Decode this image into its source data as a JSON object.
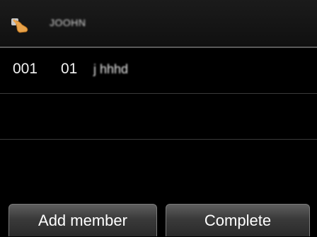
{
  "header": {
    "icon": "pointing-hand-icon",
    "title": "JOOHN"
  },
  "members": [
    {
      "number": "001",
      "index": "01",
      "name": "j hhhd"
    }
  ],
  "buttons": {
    "add_member": "Add member",
    "complete": "Complete"
  }
}
